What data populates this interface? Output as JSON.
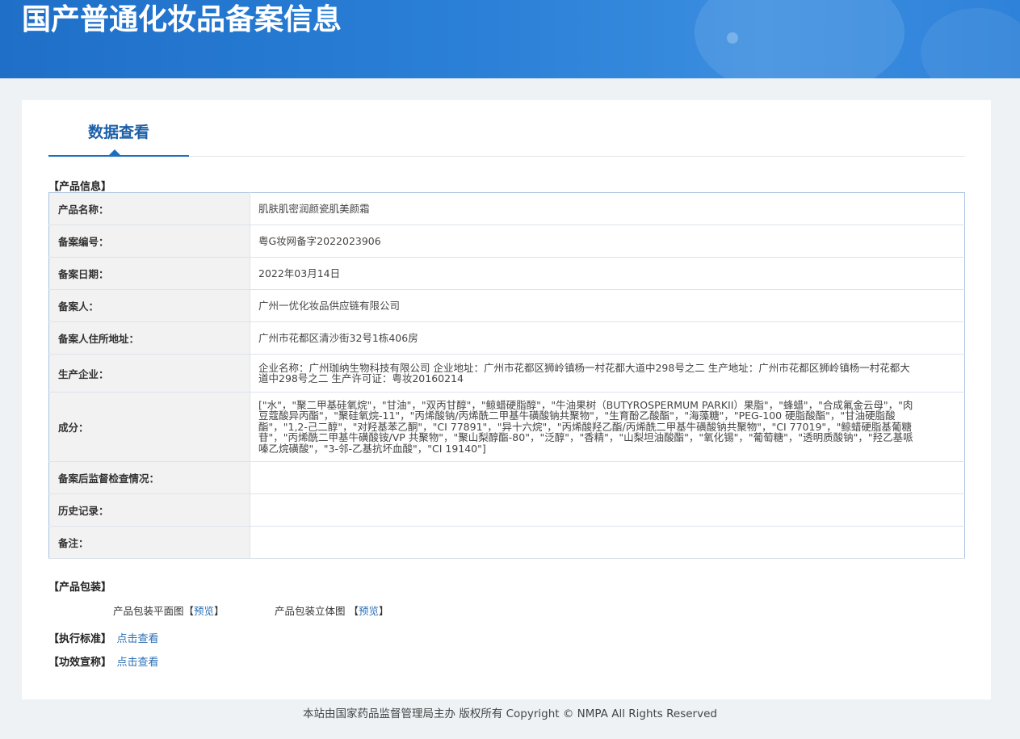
{
  "header": {
    "title": "国产普通化妆品备案信息"
  },
  "tabs": {
    "active_label": "数据查看"
  },
  "product_info": {
    "section_label": "【产品信息】",
    "rows": [
      {
        "label": "产品名称：",
        "value": "肌肤肌密润颜瓷肌美颜霜"
      },
      {
        "label": "备案编号：",
        "value": "粤G妆网备字2022023906"
      },
      {
        "label": "备案日期：",
        "value": "2022年03月14日"
      },
      {
        "label": "备案人：",
        "value": "广州一优化妆品供应链有限公司"
      },
      {
        "label": "备案人住所地址：",
        "value": "广州市花都区清沙街32号1栋406房"
      },
      {
        "label": "生产企业：",
        "value": "企业名称：广州珈纳生物科技有限公司 企业地址：广州市花都区狮岭镇杨一村花都大道中298号之二 生产地址：广州市花都区狮岭镇杨一村花都大道中298号之二 生产许可证：粤妆20160214"
      },
      {
        "label": "成分：",
        "value": "[\"水\"，\"聚二甲基硅氧烷\"，\"甘油\"，\"双丙甘醇\"，\"鲸蜡硬脂醇\"，\"牛油果树（BUTYROSPERMUM PARKII）果脂\"，\"蜂蜡\"，\"合成氟金云母\"，\"肉豆蔻酸异丙酯\"，\"聚硅氧烷-11\"，\"丙烯酸钠/丙烯酰二甲基牛磺酸钠共聚物\"，\"生育酚乙酸酯\"，\"海藻糖\"，\"PEG-100 硬脂酸酯\"，\"甘油硬脂酸酯\"，\"1,2-己二醇\"，\"对羟基苯乙酮\"，\"CI 77891\"，\"异十六烷\"，\"丙烯酸羟乙酯/丙烯酰二甲基牛磺酸钠共聚物\"，\"CI 77019\"，\"鲸蜡硬脂基葡糖苷\"，\"丙烯酰二甲基牛磺酸铵/VP 共聚物\"，\"聚山梨醇酯-80\"，\"泛醇\"，\"香精\"，\"山梨坦油酸酯\"，\"氧化锡\"，\"葡萄糖\"，\"透明质酸钠\"，\"羟乙基哌嗪乙烷磺酸\"，\"3-邻-乙基抗坏血酸\"，\"CI 19140\"]"
      },
      {
        "label": "备案后监督检查情况：",
        "value": ""
      },
      {
        "label": "历史记录：",
        "value": ""
      },
      {
        "label": "备注：",
        "value": ""
      }
    ]
  },
  "packaging": {
    "section_label": "【产品包装】",
    "flat_label": "产品包装平面图",
    "solid_label": "产品包装立体图",
    "bracket_open": "【",
    "bracket_close": "】",
    "preview_label": "预览"
  },
  "standard": {
    "section_label": "【执行标准】",
    "link_label": "点击查看"
  },
  "efficacy": {
    "section_label": "【功效宣称】",
    "link_label": "点击查看"
  },
  "footer": {
    "text": "本站由国家药品监督管理局主办 版权所有 Copyright © NMPA All Rights Reserved"
  }
}
